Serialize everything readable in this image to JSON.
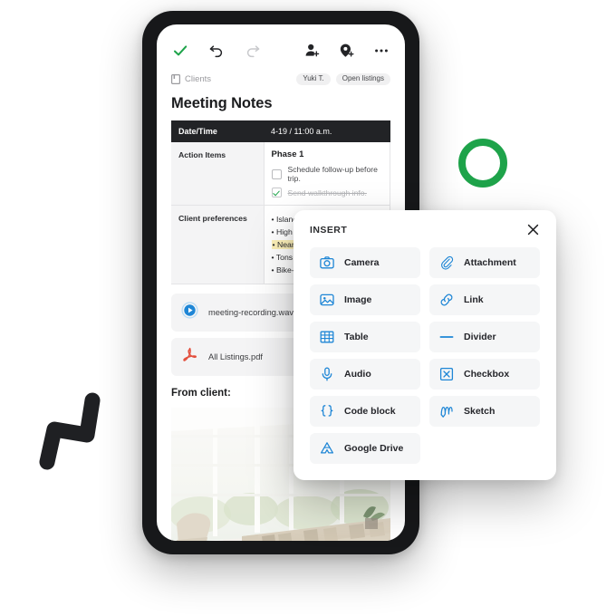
{
  "toolbar": {
    "done_label": "done-check",
    "undo_label": "undo",
    "redo_label": "redo",
    "add_person_label": "add-person",
    "add_marker_label": "add-marker",
    "more_label": "more-options"
  },
  "breadcrumb": {
    "folder": "Clients",
    "chips": [
      "Yuki T.",
      "Open listings"
    ]
  },
  "document": {
    "title": "Meeting Notes",
    "table": {
      "header": {
        "key": "Date/Time",
        "value": "4-19 / 11:00 a.m."
      },
      "rows": [
        {
          "key": "Action Items",
          "phase": "Phase 1",
          "todos": [
            {
              "text": "Schedule follow-up before trip.",
              "done": false
            },
            {
              "text": "Send walkthrough info.",
              "done": true
            }
          ]
        },
        {
          "key": "Client preferences",
          "prefs": [
            {
              "text": "• Island kitchen",
              "highlight": false
            },
            {
              "text": "• High ceilings",
              "highlight": false
            },
            {
              "text": "• Near middle school",
              "highlight": true
            },
            {
              "text": "• Tons of natural light",
              "highlight": false
            },
            {
              "text": "• Bike-friendly streets",
              "highlight": false
            }
          ]
        }
      ]
    },
    "attachments": [
      {
        "name": "meeting-recording.wav",
        "icon": "play-circle-icon"
      },
      {
        "name": "All Listings.pdf",
        "icon": "pdf-icon"
      }
    ],
    "from_client_label": "From client:",
    "photo_alt": "living-room-photo"
  },
  "insert_panel": {
    "title": "INSERT",
    "close_label": "close",
    "items": [
      {
        "label": "Camera",
        "icon": "camera-icon"
      },
      {
        "label": "Attachment",
        "icon": "paperclip-icon"
      },
      {
        "label": "Image",
        "icon": "image-icon"
      },
      {
        "label": "Link",
        "icon": "link-icon"
      },
      {
        "label": "Table",
        "icon": "table-icon"
      },
      {
        "label": "Divider",
        "icon": "divider-icon"
      },
      {
        "label": "Audio",
        "icon": "microphone-icon"
      },
      {
        "label": "Checkbox",
        "icon": "checkbox-icon"
      },
      {
        "label": "Code block",
        "icon": "code-braces-icon"
      },
      {
        "label": "Sketch",
        "icon": "sketch-icon"
      },
      {
        "label": "Google Drive",
        "icon": "google-drive-icon"
      }
    ]
  },
  "decor": {
    "ring_color": "#1ea34a",
    "squiggle_color": "#1f2023"
  },
  "colors": {
    "accent_blue": "#1e86d6",
    "green": "#1ea34a",
    "highlight_yellow": "#fcf0b8",
    "device_frame": "#17181a"
  }
}
